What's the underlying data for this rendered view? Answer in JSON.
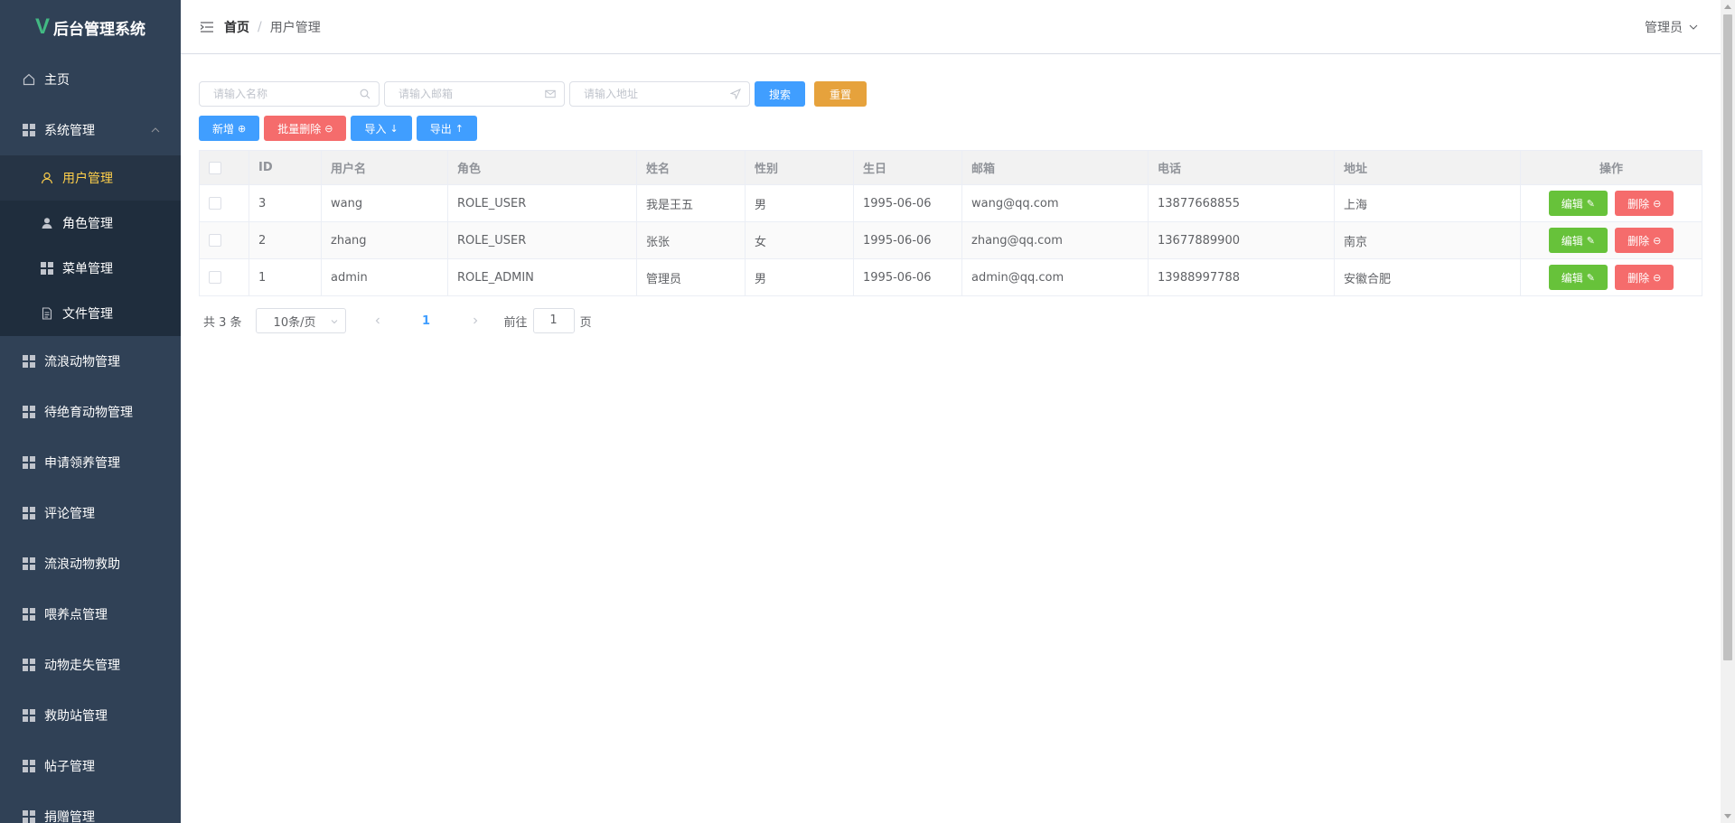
{
  "app": {
    "title": "后台管理系统",
    "logo_letter": "V"
  },
  "sidebar": {
    "items": [
      {
        "label": "主页",
        "icon": "home-icon"
      },
      {
        "label": "系统管理",
        "icon": "grid-icon",
        "expanded": true,
        "children": [
          {
            "label": "用户管理",
            "icon": "user-icon",
            "active": true
          },
          {
            "label": "角色管理",
            "icon": "person-filled-icon"
          },
          {
            "label": "菜单管理",
            "icon": "grid-icon"
          },
          {
            "label": "文件管理",
            "icon": "document-icon"
          }
        ]
      },
      {
        "label": "流浪动物管理",
        "icon": "grid-icon"
      },
      {
        "label": "待绝育动物管理",
        "icon": "grid-icon"
      },
      {
        "label": "申请领养管理",
        "icon": "grid-icon"
      },
      {
        "label": "评论管理",
        "icon": "grid-icon"
      },
      {
        "label": "流浪动物救助",
        "icon": "grid-icon"
      },
      {
        "label": "喂养点管理",
        "icon": "grid-icon"
      },
      {
        "label": "动物走失管理",
        "icon": "grid-icon"
      },
      {
        "label": "救助站管理",
        "icon": "grid-icon"
      },
      {
        "label": "帖子管理",
        "icon": "grid-icon"
      },
      {
        "label": "捐赠管理",
        "icon": "grid-icon"
      }
    ]
  },
  "header": {
    "breadcrumb": {
      "home": "首页",
      "separator": "/",
      "current": "用户管理"
    },
    "user": "管理员"
  },
  "search": {
    "name_placeholder": "请输入名称",
    "email_placeholder": "请输入邮箱",
    "address_placeholder": "请输入地址",
    "search_label": "搜索",
    "reset_label": "重置"
  },
  "actions": {
    "add_label": "新增",
    "batch_delete_label": "批量删除",
    "import_label": "导入",
    "export_label": "导出"
  },
  "table": {
    "columns": [
      "ID",
      "用户名",
      "角色",
      "姓名",
      "性别",
      "生日",
      "邮箱",
      "电话",
      "地址",
      "操作"
    ],
    "edit_label": "编辑",
    "delete_label": "删除",
    "rows": [
      {
        "id": "3",
        "username": "wang",
        "role": "ROLE_USER",
        "name": "我是王五",
        "gender": "男",
        "birthday": "1995-06-06",
        "email": "wang@qq.com",
        "phone": "13877668855",
        "address": "上海"
      },
      {
        "id": "2",
        "username": "zhang",
        "role": "ROLE_USER",
        "name": "张张",
        "gender": "女",
        "birthday": "1995-06-06",
        "email": "zhang@qq.com",
        "phone": "13677889900",
        "address": "南京"
      },
      {
        "id": "1",
        "username": "admin",
        "role": "ROLE_ADMIN",
        "name": "管理员",
        "gender": "男",
        "birthday": "1995-06-06",
        "email": "admin@qq.com",
        "phone": "13988997788",
        "address": "安徽合肥"
      }
    ]
  },
  "pagination": {
    "total_text": "共 3 条",
    "page_size": "10条/页",
    "current_page": "1",
    "goto_prefix": "前往",
    "goto_value": "1",
    "goto_suffix": "页"
  },
  "colors": {
    "sidebar_bg": "#304156",
    "active_text": "#ffd04b",
    "primary": "#409eff",
    "warning": "#e6a23c",
    "danger": "#f56c6c",
    "success": "#67c23a"
  }
}
